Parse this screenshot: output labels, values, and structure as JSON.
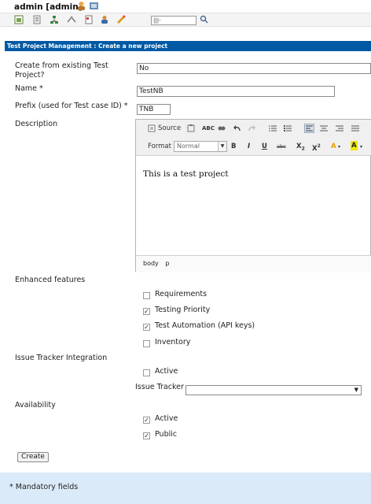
{
  "header": {
    "user_label": "admin [admin]",
    "search_value": "|||-",
    "icons": [
      "user-icon",
      "logout-icon",
      "home-icon",
      "requirements-icon",
      "specification-icon",
      "execution-icon",
      "reports-icon",
      "users-icon",
      "events-icon",
      "search-icon"
    ]
  },
  "title_bar": "Test Project Management : Create a new project",
  "form": {
    "create_from_existing_label": "Create from existing Test Project?",
    "create_from_existing_value": "No",
    "name_label": "Name *",
    "name_value": "TestNB",
    "prefix_label": "Prefix (used for Test case ID) *",
    "prefix_value": "TNB",
    "description_label": "Description",
    "editor": {
      "source_label": "Source",
      "format_label": "Format",
      "format_value": "Normal",
      "bold": "B",
      "italic": "I",
      "underline": "U",
      "strike": "abc",
      "subscript": "X",
      "subscript_mark": "2",
      "superscript": "X",
      "superscript_mark": "2",
      "text_color": "A",
      "bg_color": "A",
      "content": "This is a test project",
      "path_body": "body",
      "path_p": "p"
    },
    "enhanced_features_label": "Enhanced features",
    "features": [
      {
        "label": "Requirements",
        "checked": false
      },
      {
        "label": "Testing Priority",
        "checked": true
      },
      {
        "label": "Test Automation (API keys)",
        "checked": true
      },
      {
        "label": "Inventory",
        "checked": false
      }
    ],
    "issue_tracker_integration_label": "Issue Tracker Integration",
    "issue_tracker_active_label": "Active",
    "issue_tracker_active_checked": false,
    "issue_tracker_label": "Issue Tracker",
    "issue_tracker_value": "",
    "availability_label": "Availability",
    "availability_active_label": "Active",
    "availability_active_checked": true,
    "public_label": "Public",
    "public_checked": true,
    "create_button": "Create"
  },
  "footer": {
    "mandatory_note": "* Mandatory fields"
  },
  "colors": {
    "title_bar": "#0059a5",
    "footer": "#dbeaf8",
    "editor_toolbar": "#f0f0f0",
    "text_color_icon": "#e8a000",
    "bg_color_icon": "#f2e600"
  }
}
